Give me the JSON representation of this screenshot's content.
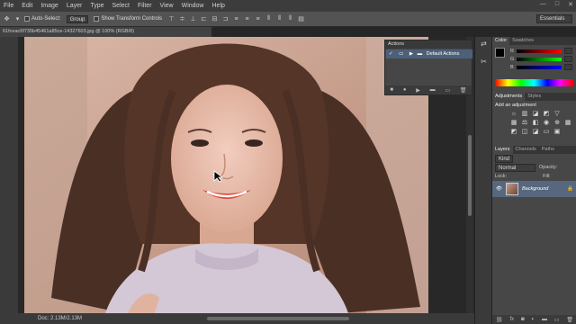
{
  "menu": [
    "File",
    "Edit",
    "Image",
    "Layer",
    "Type",
    "Select",
    "Filter",
    "View",
    "Window",
    "Help"
  ],
  "window_controls": [
    "—",
    "□",
    "✕"
  ],
  "options": {
    "auto_select_label": "Auto-Select:",
    "auto_select_value": "Group",
    "transform_label": "Show Transform Controls",
    "workspace": "Essentials"
  },
  "document_tab": "61fceac6f735b45461a85ce-14327603.jpg @ 100% (RGB/8)",
  "status": {
    "doc": "Doc: 2.13M/2.13M"
  },
  "actions_panel": {
    "title": "Actions",
    "default_set": "Default Actions",
    "footer_icons": [
      "■",
      "●",
      "▶",
      "▬",
      "▭",
      "🗑"
    ]
  },
  "color_panel": {
    "tabs": [
      "Color",
      "Swatches"
    ],
    "labels": [
      "R",
      "G",
      "B"
    ],
    "colors": {
      "fg": "#000000",
      "bg": "#ffffff"
    }
  },
  "adjustments_panel": {
    "tabs": [
      "Adjustments",
      "Styles"
    ],
    "heading": "Add an adjustment"
  },
  "layers_panel": {
    "tabs": [
      "Layers",
      "Channels",
      "Paths"
    ],
    "kind": "Kind",
    "blend": "Normal",
    "opacity_label": "Opacity:",
    "lock_label": "Lock:",
    "fill_label": "Fill:",
    "layer_name": "Background"
  }
}
